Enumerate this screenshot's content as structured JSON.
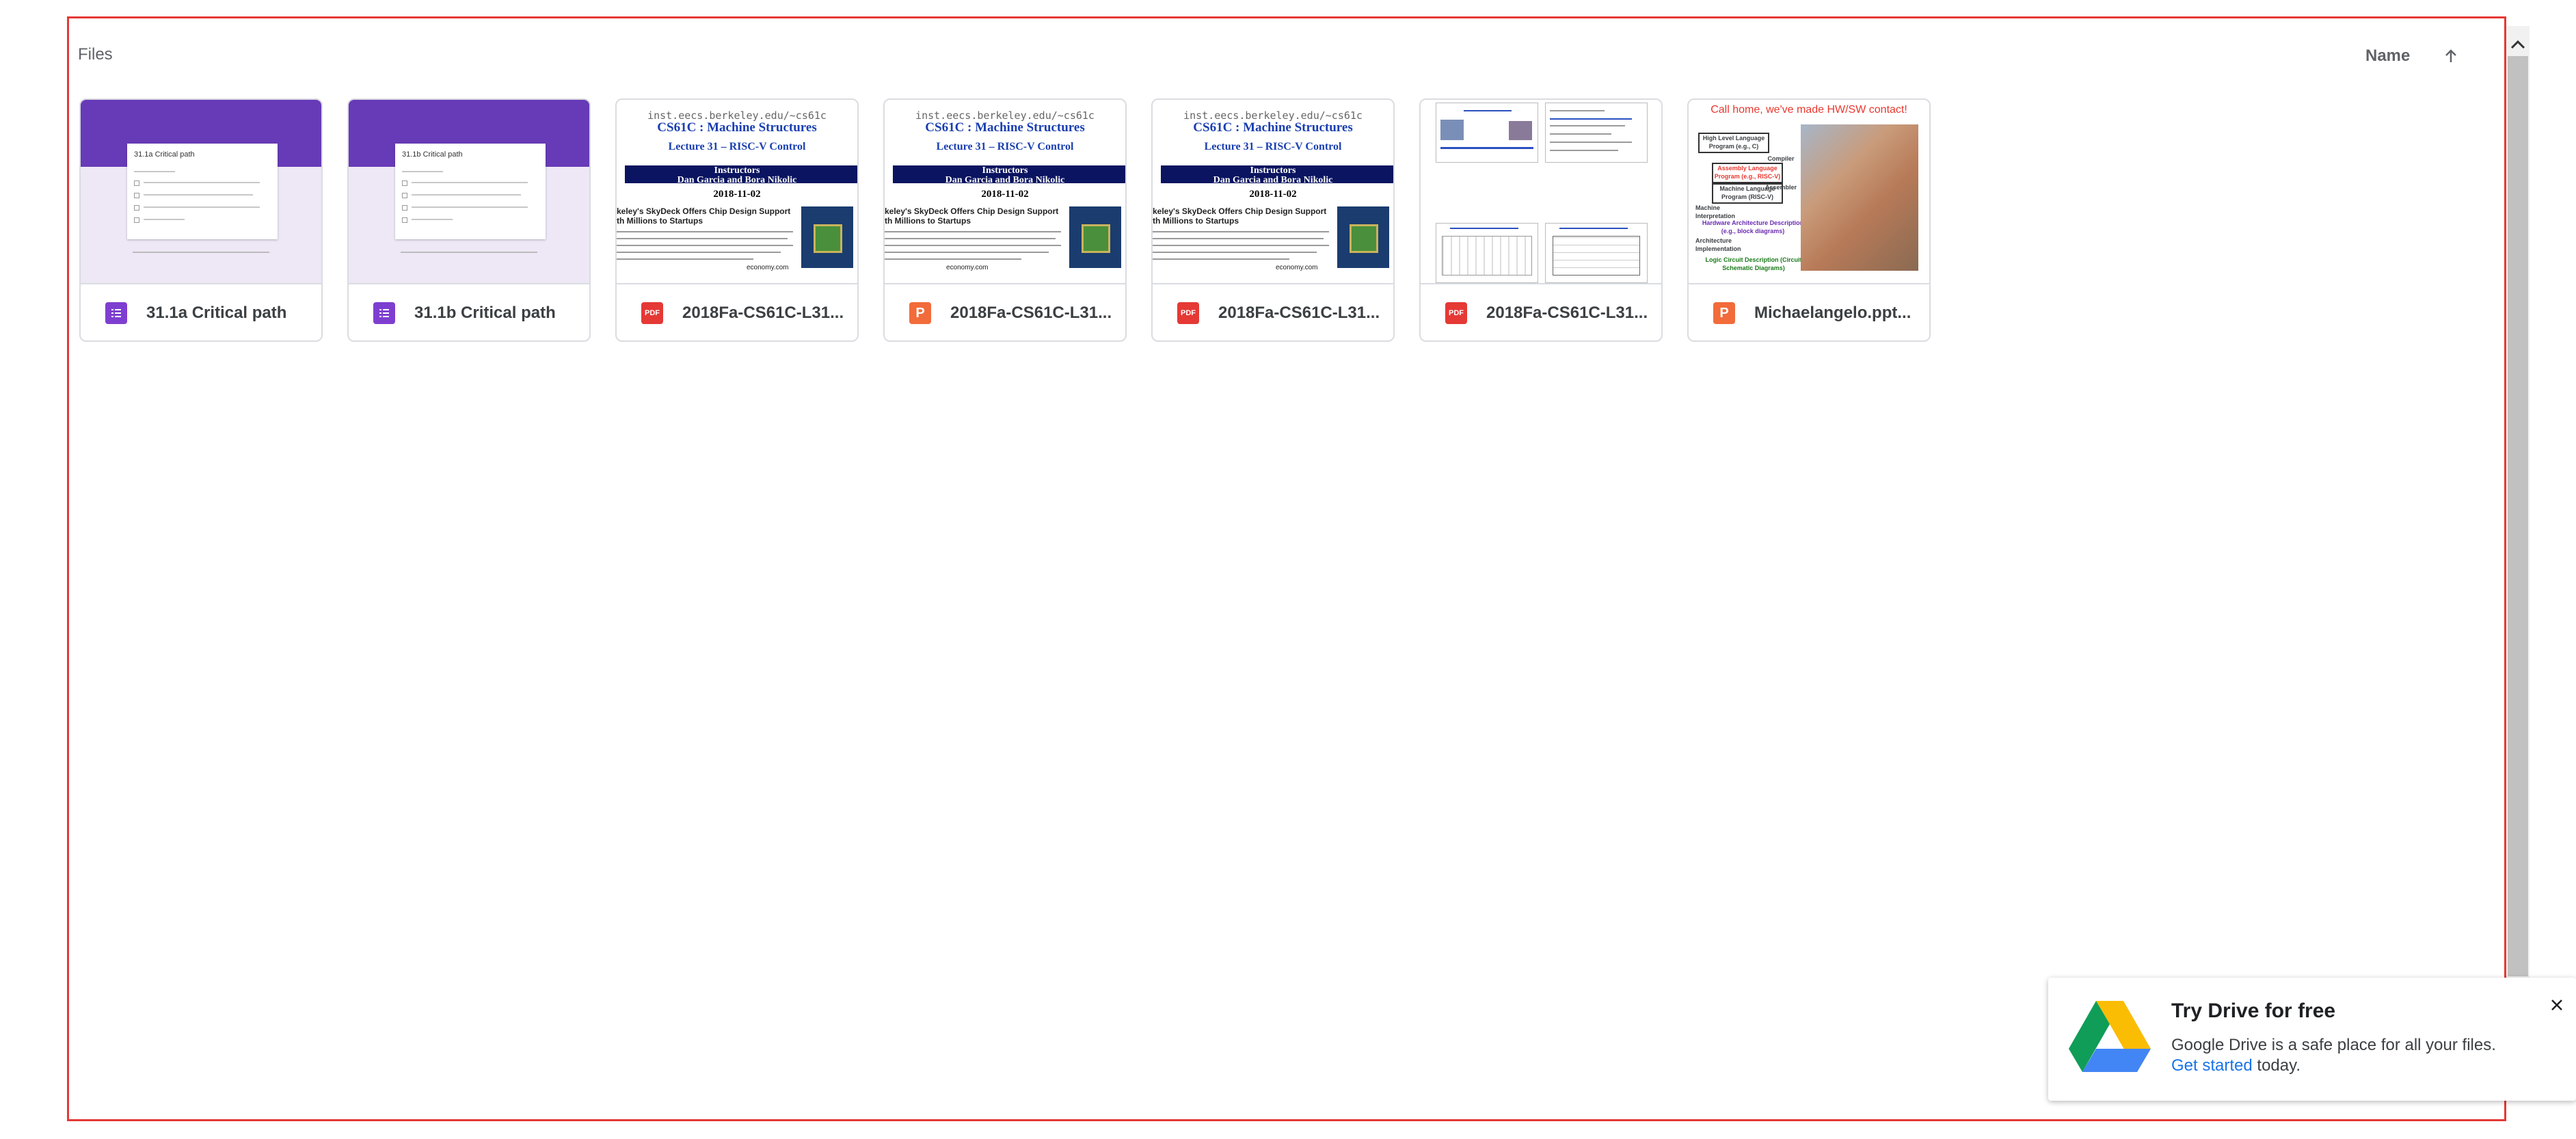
{
  "files_section": {
    "title": "Files",
    "sort_label": "Name",
    "sort_direction_icon": "arrow-up-icon"
  },
  "files": [
    {
      "name": "31.1a Critical path",
      "type": "forms",
      "thumb_title": "31.1a Critical path"
    },
    {
      "name": "31.1b Critical path",
      "type": "forms",
      "thumb_title": "31.1b Critical path"
    },
    {
      "name": "2018Fa-CS61C-L31...",
      "type": "pdf",
      "type_label": "PDF"
    },
    {
      "name": "2018Fa-CS61C-L31...",
      "type": "ppt",
      "type_label": "P"
    },
    {
      "name": "2018Fa-CS61C-L31...",
      "type": "pdf",
      "type_label": "PDF"
    },
    {
      "name": "2018Fa-CS61C-L31...",
      "type": "pdf",
      "type_label": "PDF"
    },
    {
      "name": "Michaelangelo.ppt...",
      "type": "ppt",
      "type_label": "P"
    }
  ],
  "slide": {
    "url": "inst.eecs.berkeley.edu/~cs61c",
    "course": "CS61C : Machine Structures",
    "lecture": "Lecture 31 – RISC-V Control",
    "instructors_label": "Instructors",
    "instructors": "Dan Garcia and Bora Nikolic",
    "date": "2018-11-02",
    "headline_1": "keley's SkyDeck Offers Chip Design Support",
    "headline_2": "th Millions to Startups",
    "source": "economy.com"
  },
  "michaelangelo_thumb": {
    "title": "Call home, we've made HW/SW contact!",
    "levels": [
      "High Level Language Program (e.g., C)",
      "Compiler",
      "Assembly Language Program (e.g., RISC-V)",
      "Assembler",
      "Machine Language Program (RISC-V)",
      "Machine Interpretation",
      "Hardware Architecture Description (e.g., block diagrams)",
      "Architecture Implementation",
      "Logic Circuit Description (Circuit Schematic Diagrams)"
    ]
  },
  "toast": {
    "title": "Try Drive for free",
    "body": "Google Drive is a safe place for all your files.",
    "link": "Get started",
    "suffix": " today.",
    "close_icon": "close-icon"
  },
  "colors": {
    "forms": "#7e3fd0",
    "pdf": "#e53935",
    "ppt": "#f26b3a",
    "frame": "#e53935",
    "link": "#1a73e8"
  }
}
